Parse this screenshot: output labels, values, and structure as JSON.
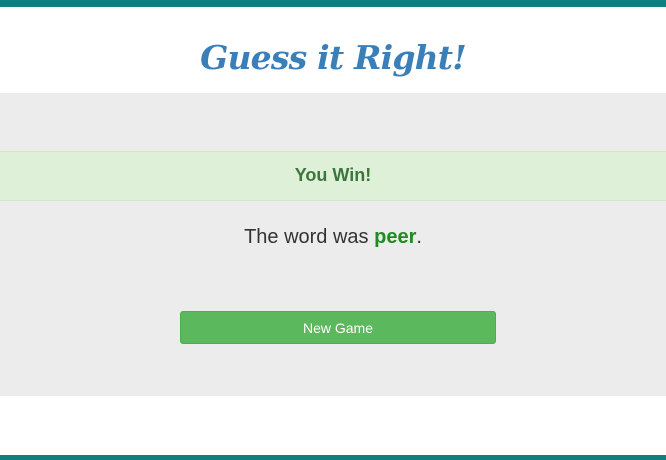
{
  "app": {
    "title": "Guess it Right!"
  },
  "game": {
    "status": "You Win!",
    "result_prefix": "The word was",
    "word": "peer",
    "result_suffix": ".",
    "new_game_label": "New Game"
  },
  "colors": {
    "accent_bar": "#0f7f7f",
    "title": "#3b7fb8",
    "panel_background": "#ececec",
    "success_background": "#dff0d8",
    "success_text": "#3c763d",
    "word": "#1e8c1e",
    "button": "#5cb85c"
  }
}
